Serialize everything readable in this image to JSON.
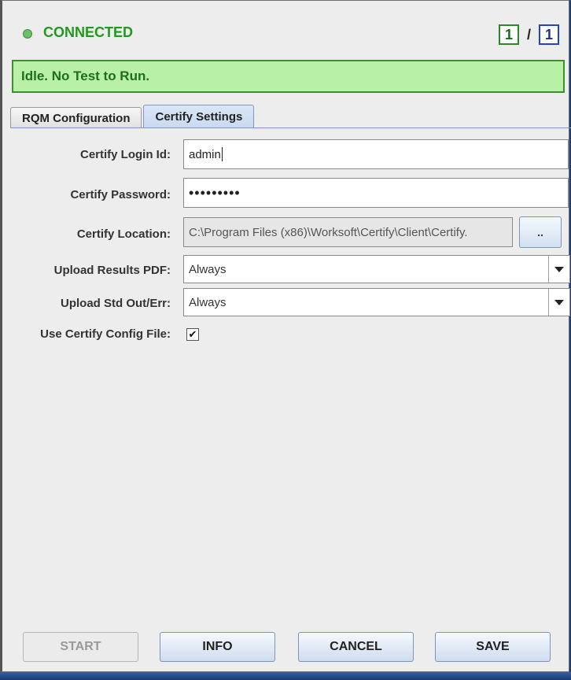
{
  "status": {
    "connection": "CONNECTED",
    "counter_current": "1",
    "counter_separator": "/",
    "counter_total": "1",
    "banner": "Idle. No Test to Run."
  },
  "tabs": [
    {
      "label": "RQM Configuration",
      "active": false
    },
    {
      "label": "Certify Settings",
      "active": true
    }
  ],
  "form": {
    "login_label": "Certify Login Id:",
    "login_value": "admin",
    "password_label": "Certify Password:",
    "password_value": "•••••••••",
    "location_label": "Certify Location:",
    "location_value": "C:\\Program Files (x86)\\Worksoft\\Certify\\Client\\Certify.",
    "browse_label": "..",
    "upload_pdf_label": "Upload Results PDF:",
    "upload_pdf_value": "Always",
    "upload_std_label": "Upload Std Out/Err:",
    "upload_std_value": "Always",
    "config_file_label": "Use Certify Config File:",
    "config_file_checked": true,
    "checkmark": "✔"
  },
  "buttons": {
    "start": "START",
    "info": "INFO",
    "cancel": "CANCEL",
    "save": "SAVE"
  },
  "colors": {
    "connected": "#1f9a1f",
    "banner_bg": "#b8f0a8",
    "banner_border": "#3f8f2f"
  }
}
